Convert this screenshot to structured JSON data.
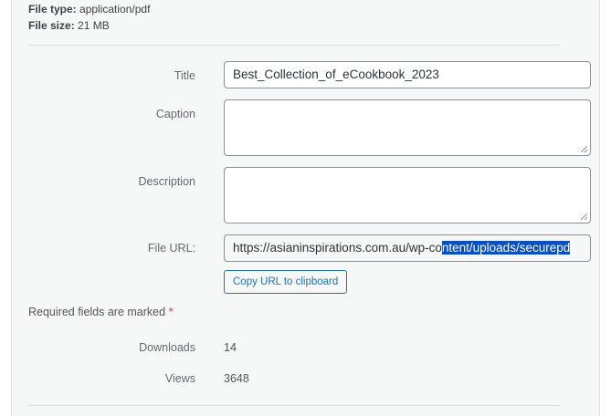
{
  "file_info": {
    "type_label": "File type:",
    "type_value": "application/pdf",
    "size_label": "File size:",
    "size_value": "21 MB"
  },
  "fields": {
    "title_label": "Title",
    "title_value": "Best_Collection_of_eCookbook_2023",
    "caption_label": "Caption",
    "caption_value": "",
    "description_label": "Description",
    "description_value": "",
    "file_url_label": "File URL:",
    "file_url_unselected": "https://asianinspirations.com.au/wp-co",
    "file_url_selected": "ntent/uploads/securepd",
    "copy_button_label": "Copy URL to clipboard"
  },
  "required_note": {
    "text": "Required fields are marked",
    "marker": "*"
  },
  "stats": {
    "downloads_label": "Downloads",
    "downloads_value": "14",
    "views_label": "Views",
    "views_value": "3648"
  },
  "colors": {
    "panel_bg": "#f6f7f7",
    "link_blue": "#2271b1",
    "selection_blue": "#0a4fc0",
    "required_red": "#d63638"
  }
}
